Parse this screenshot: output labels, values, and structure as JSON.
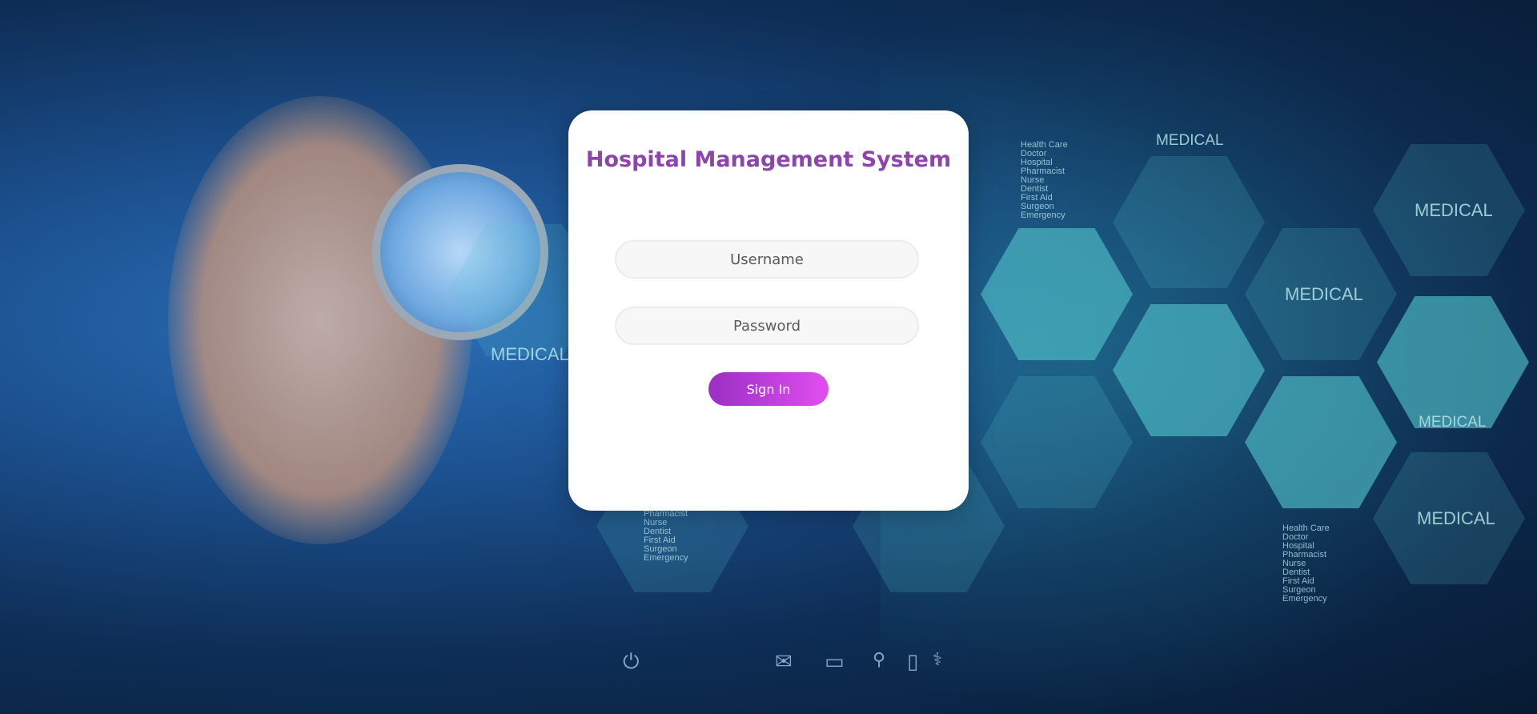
{
  "login": {
    "title": "Hospital Management System",
    "username_placeholder": "Username",
    "password_placeholder": "Password",
    "signin_label": "Sign In"
  },
  "background": {
    "hex_labels": [
      "MEDICAL",
      "MEDICAL",
      "MEDICAL",
      "MEDICAL",
      "MEDICAL",
      "MEDICAL"
    ],
    "list_top": "Health Care\nDoctor\nHospital\nPharmacist\nNurse\nDentist\nFirst Aid\nSurgeon\nEmergency",
    "list_bottom_left": "Pharmacist\nNurse\nDentist\nFirst Aid\nSurgeon\nEmergency",
    "list_bottom_right": "Health Care\nDoctor\nHospital\nPharmacist\nNurse\nDentist\nFirst Aid\nSurgeon\nEmergency"
  },
  "icons": [
    "power-icon",
    "mail-icon",
    "monitor-icon",
    "search-icon",
    "phone-icon",
    "stethoscope-icon"
  ]
}
